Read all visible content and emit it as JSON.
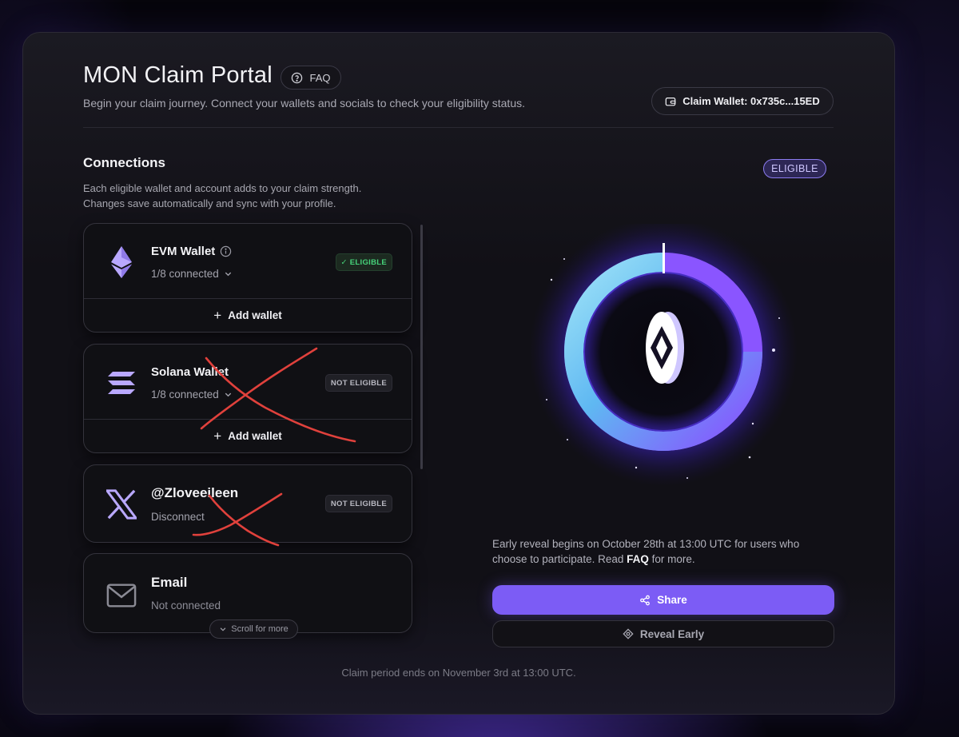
{
  "header": {
    "title": "MON Claim Portal",
    "faq_label": "FAQ",
    "subtitle": "Begin your claim journey. Connect your wallets and socials to check your eligibility status.",
    "claim_wallet_label": "Claim Wallet: 0x735c...15ED"
  },
  "connections": {
    "title": "Connections",
    "description_line1": "Each eligible wallet and account adds to your claim strength.",
    "description_line2": "Changes save automatically and sync with your profile.",
    "overall_status": "ELIGIBLE",
    "scroll_hint": "Scroll for more",
    "cards": [
      {
        "name": "EVM Wallet",
        "sub": "1/8 connected",
        "badge": "ELIGIBLE",
        "badge_icon": "check-icon",
        "action": "Add wallet",
        "icon": "ethereum-icon"
      },
      {
        "name": "Solana Wallet",
        "sub": "1/8 connected",
        "badge": "NOT ELIGIBLE",
        "action": "Add wallet",
        "icon": "solana-icon"
      },
      {
        "name": "@Zloveeileen",
        "sub": "Disconnect",
        "badge": "NOT ELIGIBLE",
        "icon": "x-logo-icon"
      },
      {
        "name": "Email",
        "sub": "Not connected",
        "icon": "mail-icon"
      }
    ]
  },
  "reveal": {
    "text_before": "Early reveal begins on October 28th at 13:00 UTC for users who choose to participate. Read ",
    "faq_link": "FAQ",
    "text_after": " for more.",
    "share_label": "Share",
    "reveal_label": "Reveal Early"
  },
  "footer": {
    "text": "Claim period ends on November 3rd at 13:00 UTC."
  },
  "colors": {
    "accent": "#7c5cf5",
    "eligible_green": "#46d37a",
    "ring_start": "#7fd8f5",
    "ring_end": "#8a4dff",
    "annotation_red": "#e0413c"
  }
}
